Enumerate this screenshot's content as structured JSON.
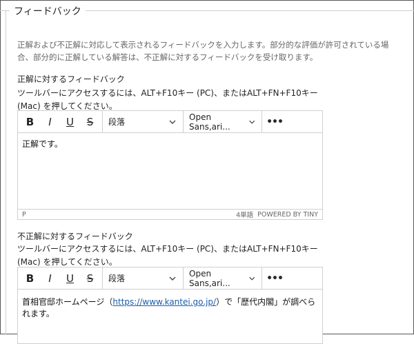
{
  "section": {
    "legend": "フィードバック"
  },
  "help_text": "正解および不正解に対応して表示されるフィードバックを入力します。部分的な評価が許可されている場合、部分的に正解している解答は、不正解に対するフィードバックを受け取ります。",
  "correct": {
    "label": "正解に対するフィードバック",
    "toolbar_hint": "ツールバーにアクセスするには、ALT+F10キー (PC)、またはALT+FN+F10キー (Mac) を押してください。",
    "toolbar": {
      "bold": "B",
      "italic": "I",
      "underline": "U",
      "strike": "S",
      "block": "段落",
      "font": "Open Sans,ari...",
      "more": "•••"
    },
    "content": "正解です。",
    "status": {
      "path": "P",
      "words": "4単語",
      "powered": "POWERED BY TINY"
    }
  },
  "incorrect": {
    "label": "不正解に対するフィードバック",
    "toolbar_hint": "ツールバーにアクセスするには、ALT+F10キー (PC)、またはALT+FN+F10キー (Mac) を押してください。",
    "toolbar": {
      "bold": "B",
      "italic": "I",
      "underline": "U",
      "strike": "S",
      "block": "段落",
      "font": "Open Sans,ari...",
      "more": "•••"
    },
    "content_pre": "首相官邸ホームページ（",
    "content_link": "https://www.kantei.go.jp/",
    "content_post": "）で「歴代内閣」が調べられます。"
  }
}
